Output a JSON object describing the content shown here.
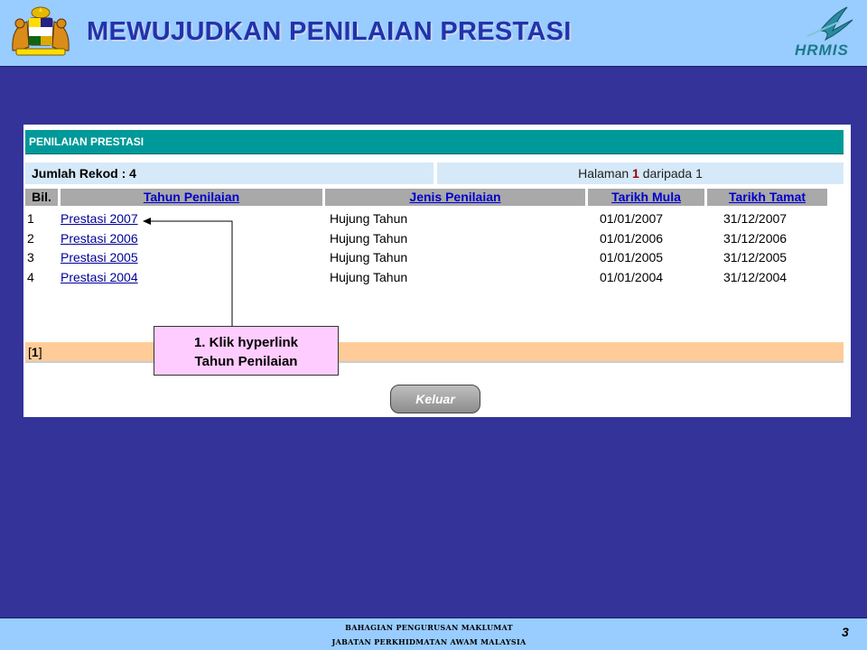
{
  "header": {
    "title": "MEWUJUDKAN PENILAIAN PRESTASI",
    "logo_text": "HRMIS",
    "crest_icon": "malaysia-coat-of-arms-icon",
    "logo_icon": "hrmis-swoosh-icon"
  },
  "panel": {
    "title": "PENILAIAN PRESTASI",
    "record_count": "Jumlah Rekod : 4",
    "page_prefix": "Halaman",
    "page_current": "1",
    "page_suffix": "daripada 1",
    "columns": {
      "bil": "Bil.",
      "tahun": "Tahun Penilaian",
      "jenis": "Jenis Penilaian",
      "mula": "Tarikh Mula",
      "tamat": "Tarikh Tamat"
    },
    "rows": [
      {
        "no": "1",
        "tahun": "Prestasi 2007",
        "jenis": "Hujung Tahun",
        "mula": "01/01/2007",
        "tamat": "31/12/2007"
      },
      {
        "no": "2",
        "tahun": "Prestasi 2006",
        "jenis": "Hujung Tahun",
        "mula": "01/01/2006",
        "tamat": "31/12/2006"
      },
      {
        "no": "3",
        "tahun": "Prestasi 2005",
        "jenis": "Hujung Tahun",
        "mula": "01/01/2005",
        "tamat": "31/12/2005"
      },
      {
        "no": "4",
        "tahun": "Prestasi 2004",
        "jenis": "Hujung Tahun",
        "mula": "01/01/2004",
        "tamat": "31/12/2004"
      }
    ],
    "pager": "1",
    "keluar_label": "Keluar"
  },
  "callout": {
    "line1": "1. Klik hyperlink",
    "line2": "Tahun Penilaian"
  },
  "footer": {
    "line1": "BAHAGIAN PENGURUSAN MAKLUMAT",
    "line2": "JABATAN PERKHIDMATAN AWAM MALAYSIA",
    "page_number": "3"
  },
  "colors": {
    "background": "#333399",
    "header_bar": "#99ccff",
    "panel_title": "#009999",
    "info_bar": "#d6e9f8",
    "pager_bar": "#ffcc99",
    "callout_bg": "#ffccff"
  }
}
